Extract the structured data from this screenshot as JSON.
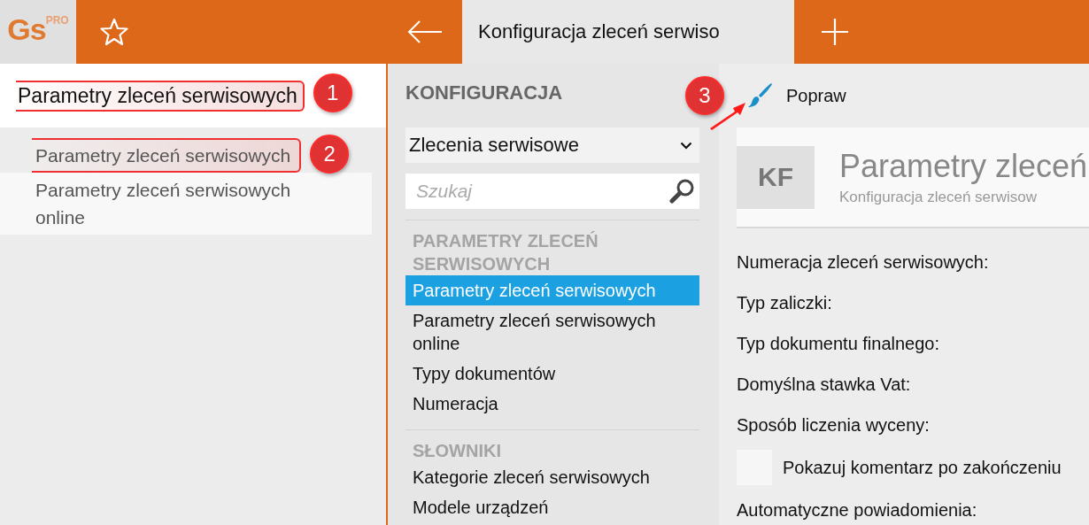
{
  "topbar": {
    "logo": "Gs",
    "logo_badge": "PRO",
    "tab_title": "Konfiguracja zleceń serwiso"
  },
  "left_panel": {
    "title": "Parametry zleceń serwisowych",
    "title_marker": "1",
    "items": [
      {
        "label": "Parametry zleceń serwisowych",
        "highlighted": false,
        "marker": "2"
      },
      {
        "label": "Parametry zleceń serwisowych online",
        "highlighted": true
      }
    ]
  },
  "config": {
    "heading": "KONFIGURACJA",
    "dropdown": "Zlecenia serwisowe",
    "search": {
      "placeholder": "Szukaj"
    },
    "sections": [
      {
        "title": "PARAMETRY ZLECEŃ SERWISOWYCH",
        "items": [
          {
            "label": "Parametry zleceń serwisowych",
            "selected": true
          },
          {
            "label": "Parametry zleceń serwisowych online",
            "selected": false
          },
          {
            "label": "Typy dokumentów",
            "selected": false
          },
          {
            "label": "Numeracja",
            "selected": false
          }
        ]
      },
      {
        "title": "SŁOWNIKI",
        "items": [
          {
            "label": "Kategorie zleceń serwisowych",
            "selected": false
          },
          {
            "label": "Modele urządzeń",
            "selected": false
          }
        ]
      }
    ]
  },
  "toolbar": {
    "button": "Popraw",
    "marker": "3"
  },
  "header": {
    "initials": "KF",
    "title": "Parametry zleceń",
    "subtitle": "Konfiguracja zleceń serwisow"
  },
  "form": [
    {
      "kind": "label",
      "text": "Numeracja zleceń serwisowych:"
    },
    {
      "kind": "label",
      "text": "Typ zaliczki:"
    },
    {
      "kind": "label",
      "text": "Typ dokumentu finalnego:"
    },
    {
      "kind": "label",
      "text": "Domyślna stawka Vat:"
    },
    {
      "kind": "label",
      "text": "Sposób liczenia wyceny:"
    },
    {
      "kind": "checkbox",
      "text": "Pokazuj komentarz po zakończeniu",
      "checked": false
    },
    {
      "kind": "label",
      "text": "Automatyczne powiadomienia:"
    }
  ]
}
